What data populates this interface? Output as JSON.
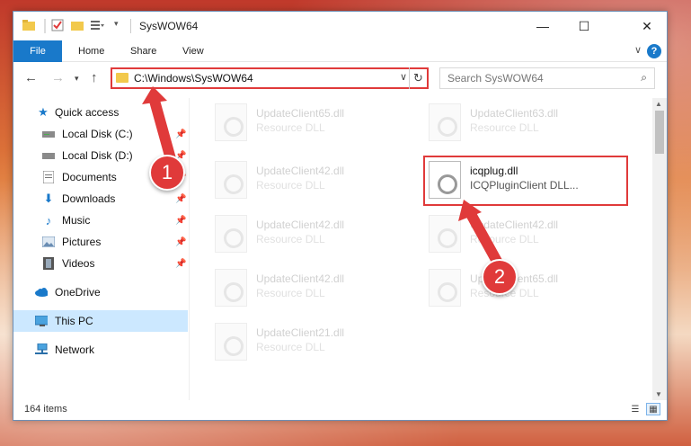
{
  "window": {
    "title": "SysWOW64"
  },
  "ribbon": {
    "file": "File",
    "tabs": [
      "Home",
      "Share",
      "View"
    ]
  },
  "nav": {
    "address": "C:\\Windows\\SysWOW64",
    "search_placeholder": "Search SysWOW64"
  },
  "sidebar": {
    "items": [
      {
        "label": "Quick access",
        "icon": "star-icon"
      },
      {
        "label": "Local Disk (C:)",
        "icon": "drive-icon"
      },
      {
        "label": "Local Disk (D:)",
        "icon": "drive-icon"
      },
      {
        "label": "Documents",
        "icon": "documents-icon"
      },
      {
        "label": "Downloads",
        "icon": "download-icon"
      },
      {
        "label": "Music",
        "icon": "music-icon"
      },
      {
        "label": "Pictures",
        "icon": "pictures-icon"
      },
      {
        "label": "Videos",
        "icon": "videos-icon"
      },
      {
        "label": "OneDrive",
        "icon": "cloud-icon"
      },
      {
        "label": "This PC",
        "icon": "computer-icon"
      },
      {
        "label": "Network",
        "icon": "network-icon"
      }
    ]
  },
  "files": [
    {
      "name": "UpdateClient65.dll",
      "type": "Resource DLL"
    },
    {
      "name": "UpdateClient63.dll",
      "type": "Resource DLL"
    },
    {
      "name": "UpdateClient42.dll",
      "type": "Resource DLL"
    },
    {
      "name": "icqplug.dll",
      "type": "ICQPluginClient DLL..."
    },
    {
      "name": "UpdateClient42.dll",
      "type": "Resource DLL"
    },
    {
      "name": "UpdateClient42.dll",
      "type": "Resource DLL"
    },
    {
      "name": "UpdateClient42.dll",
      "type": "Resource DLL"
    },
    {
      "name": "UpdateClient65.dll",
      "type": "Resource DLL"
    },
    {
      "name": "UpdateClient21.dll",
      "type": "Resource DLL"
    }
  ],
  "status": {
    "count": "164 items"
  },
  "callouts": {
    "one": "1",
    "two": "2"
  },
  "colors": {
    "accent": "#1979ca",
    "highlight": "#e03a3a"
  }
}
